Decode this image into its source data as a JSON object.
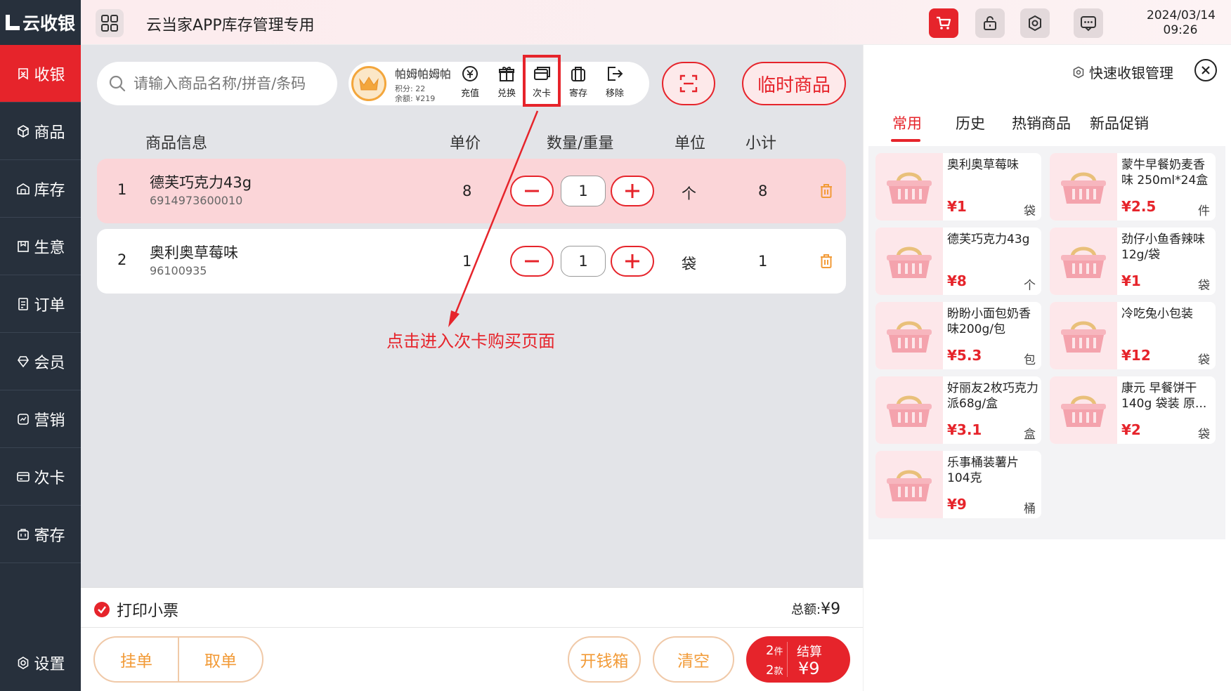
{
  "sidebar": {
    "logo": "云收银",
    "items": [
      {
        "label": "收银",
        "icon": "cashier-icon",
        "active": true
      },
      {
        "label": "商品",
        "icon": "box-icon"
      },
      {
        "label": "库存",
        "icon": "warehouse-icon"
      },
      {
        "label": "生意",
        "icon": "business-icon"
      },
      {
        "label": "订单",
        "icon": "order-icon"
      },
      {
        "label": "会员",
        "icon": "member-icon"
      },
      {
        "label": "营销",
        "icon": "marketing-icon"
      },
      {
        "label": "次卡",
        "icon": "card-icon"
      },
      {
        "label": "寄存",
        "icon": "storage-icon"
      }
    ],
    "settings": "设置"
  },
  "header": {
    "title": "云当家APP库存管理专用",
    "date": "2024/03/14",
    "time": "09:26"
  },
  "search": {
    "placeholder": "请输入商品名称/拼音/条码"
  },
  "member": {
    "name": "帕姆帕姆帕",
    "points": "积分: 22",
    "balance": "余额: ¥219",
    "actions": [
      "充值",
      "兑换",
      "次卡",
      "寄存",
      "移除"
    ]
  },
  "temp_goods": "临时商品",
  "table": {
    "headers": [
      "商品信息",
      "单价",
      "数量/重量",
      "单位",
      "小计"
    ],
    "rows": [
      {
        "index": "1",
        "name": "德芙巧克力43g",
        "code": "6914973600010",
        "price": "8",
        "qty": "1",
        "unit": "个",
        "subtotal": "8"
      },
      {
        "index": "2",
        "name": "奥利奥草莓味",
        "code": "96100935",
        "price": "1",
        "qty": "1",
        "unit": "袋",
        "subtotal": "1"
      }
    ]
  },
  "annotation": "点击进入次卡购买页面",
  "footer": {
    "print": "打印小票",
    "total_label": "总额:",
    "total_value": "¥9",
    "hang": "挂单",
    "take": "取单",
    "cash_drawer": "开钱箱",
    "clear": "清空",
    "items_count": "2",
    "items_unit": "件",
    "kinds_count": "2",
    "kinds_unit": "款",
    "checkout_label": "结算",
    "checkout_amount": "¥9"
  },
  "right": {
    "quick_manage": "快速收银管理",
    "tabs": [
      "常用",
      "历史",
      "热销商品",
      "新品促销"
    ],
    "products": [
      {
        "name": "奥利奥草莓味",
        "price": "¥1",
        "unit": "袋"
      },
      {
        "name": "蒙牛早餐奶麦香味 250ml*24盒",
        "price": "¥2.5",
        "unit": "件"
      },
      {
        "name": "德芙巧克力43g",
        "price": "¥8",
        "unit": "个"
      },
      {
        "name": "劲仔小鱼香辣味12g/袋",
        "price": "¥1",
        "unit": "袋"
      },
      {
        "name": "盼盼小面包奶香味200g/包",
        "price": "¥5.3",
        "unit": "包"
      },
      {
        "name": "冷吃兔小包装",
        "price": "¥12",
        "unit": "袋"
      },
      {
        "name": "好丽友2枚巧克力派68g/盒",
        "price": "¥3.1",
        "unit": "盒"
      },
      {
        "name": "康元 早餐饼干140g 袋装 原...",
        "price": "¥2",
        "unit": "袋"
      },
      {
        "name": "乐事桶装薯片104克",
        "price": "¥9",
        "unit": "桶"
      }
    ]
  },
  "colors": {
    "accent": "#e6242b",
    "sidebar": "#27303c",
    "orange": "#f29b38"
  }
}
